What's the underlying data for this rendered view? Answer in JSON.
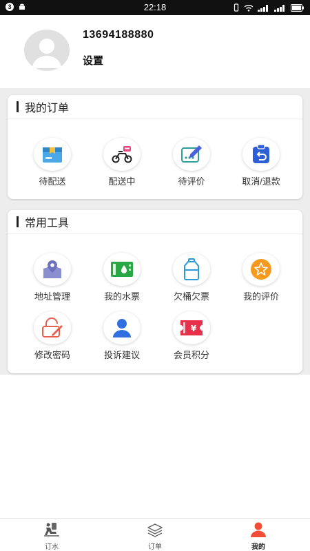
{
  "status_bar": {
    "notification_count": "3",
    "time": "22:18"
  },
  "profile": {
    "phone": "13694188880",
    "settings_label": "设置"
  },
  "orders_section": {
    "title": "我的订单",
    "items": [
      {
        "label": "待配送",
        "icon": "box-icon"
      },
      {
        "label": "配送中",
        "icon": "scooter-icon"
      },
      {
        "label": "待评价",
        "icon": "review-pen-icon"
      },
      {
        "label": "取消/退款",
        "icon": "refund-clipboard-icon"
      }
    ]
  },
  "tools_section": {
    "title": "常用工具",
    "items": [
      {
        "label": "地址管理",
        "icon": "location-pin-icon"
      },
      {
        "label": "我的水票",
        "icon": "water-ticket-icon"
      },
      {
        "label": "欠桶欠票",
        "icon": "water-bottle-icon"
      },
      {
        "label": "我的评价",
        "icon": "star-icon"
      },
      {
        "label": "修改密码",
        "icon": "lock-edit-icon"
      },
      {
        "label": "投诉建议",
        "icon": "user-icon"
      },
      {
        "label": "会员积分",
        "icon": "yen-ticket-icon"
      }
    ]
  },
  "tab_bar": {
    "tabs": [
      {
        "label": "订水",
        "icon": "water-delivery-icon"
      },
      {
        "label": "订单",
        "icon": "layers-icon"
      },
      {
        "label": "我的",
        "icon": "person-icon",
        "active": true
      }
    ]
  },
  "colors": {
    "accent": "#f04e37",
    "page_gray": "#ededed"
  }
}
